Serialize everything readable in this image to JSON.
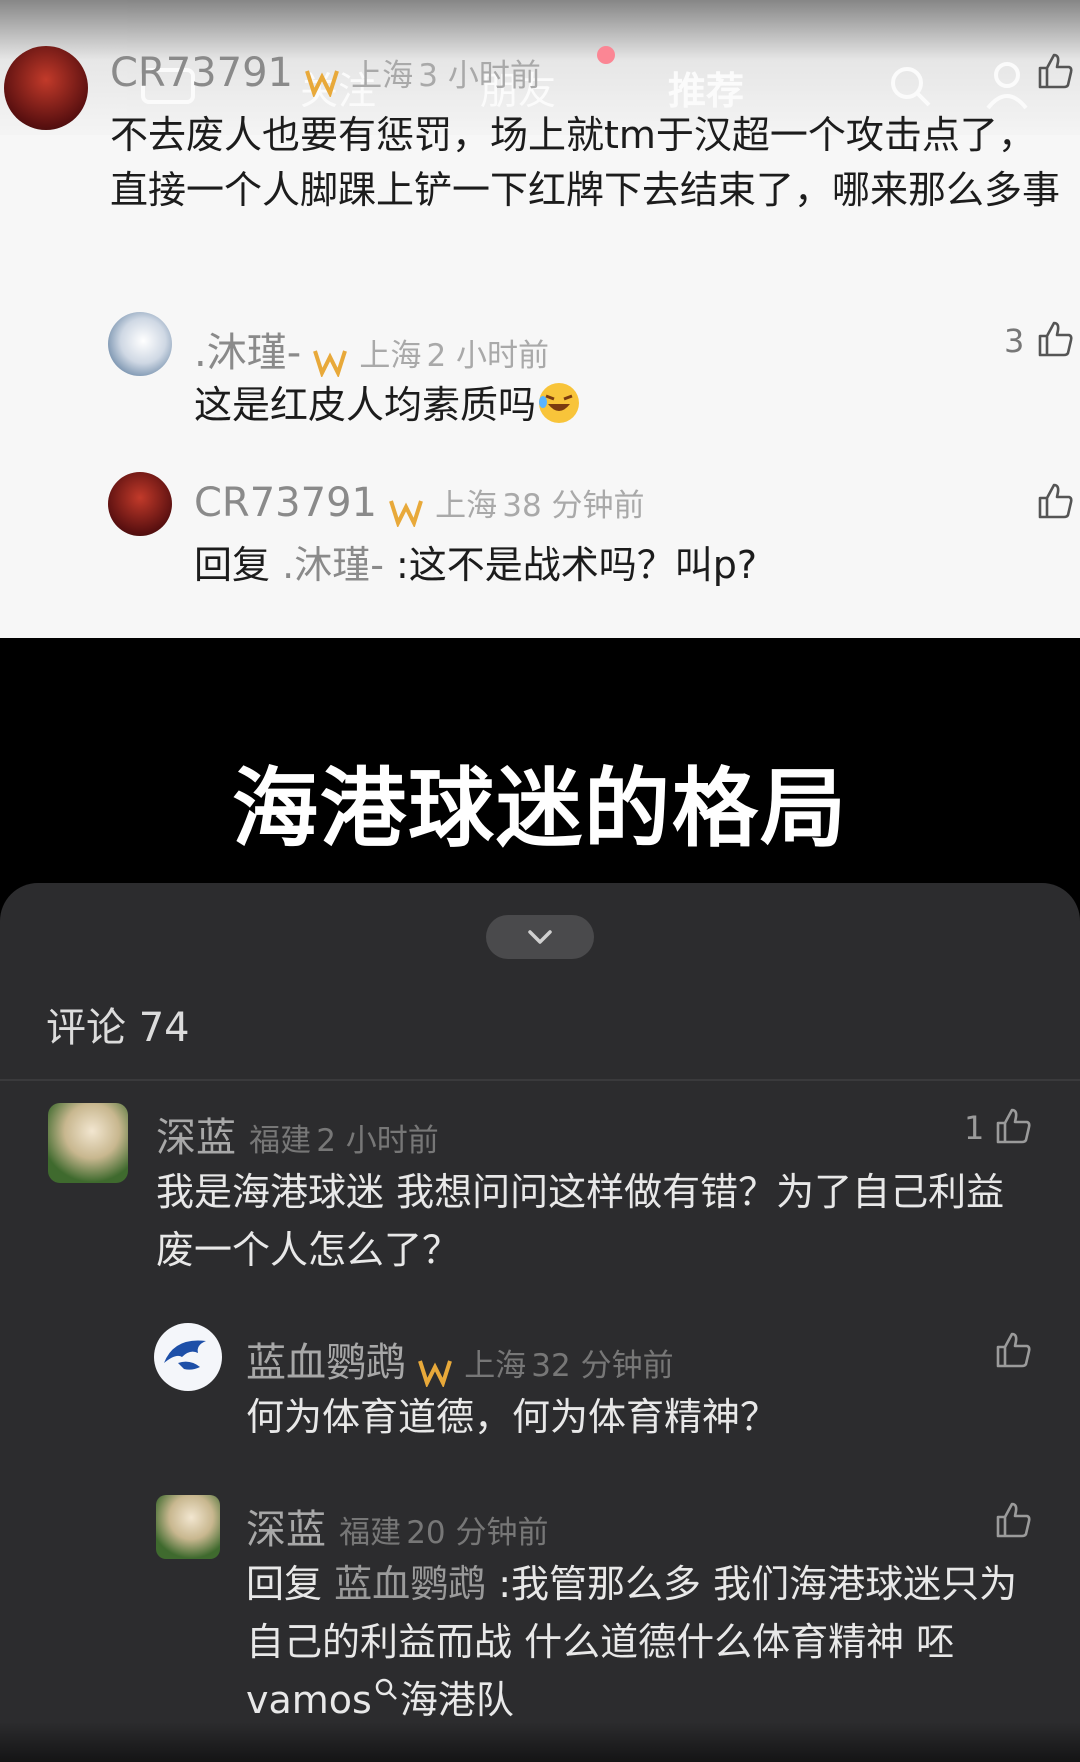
{
  "top_nav": {
    "tabs": [
      "关注",
      "朋友",
      "推荐"
    ]
  },
  "top_comments": [
    {
      "user": "CR73791",
      "location": "上海",
      "time": "3 小时前",
      "text": "不去废人也要有惩罚，场上就tm于汉超一个攻击点了，直接一个人脚踝上铲一下红牌下去结束了，哪来那么多事"
    },
    {
      "user": ".沐瑾-",
      "location": "上海",
      "time": "2 小时前",
      "text": "这是红皮人均素质吗",
      "likes": "3"
    },
    {
      "user": "CR73791",
      "location": "上海",
      "time": "38 分钟前",
      "reply_prefix": "回复",
      "reply_to": ".沐瑾-",
      "text": ":这不是战术吗？叫p?"
    }
  ],
  "title": "海港球迷的格局",
  "comment_sheet": {
    "count_label": "评论 74",
    "comments": [
      {
        "user": "深蓝",
        "location": "福建",
        "time": "2 小时前",
        "likes": "1",
        "text": "我是海港球迷 我想问问这样做有错？为了自己利益废一个人怎么了？"
      },
      {
        "user": "蓝血鹦鹉",
        "location": "上海",
        "time": "32 分钟前",
        "text": "何为体育道德，何为体育精神？"
      },
      {
        "user": "深蓝",
        "location": "福建",
        "time": "20 分钟前",
        "reply_prefix": "回复",
        "reply_to": "蓝血鹦鹉",
        "text": ":我管那么多 我们海港球迷只为自己的利益而战 什么道德什么体育精神 呸 vamos",
        "search_link": "海港队"
      }
    ]
  },
  "colors": {
    "light_bg": "#f7f7f7",
    "dark_sheet": "#2c2c2e",
    "badge_gold": "#e8a93a",
    "notification_red": "#ff2b44"
  }
}
